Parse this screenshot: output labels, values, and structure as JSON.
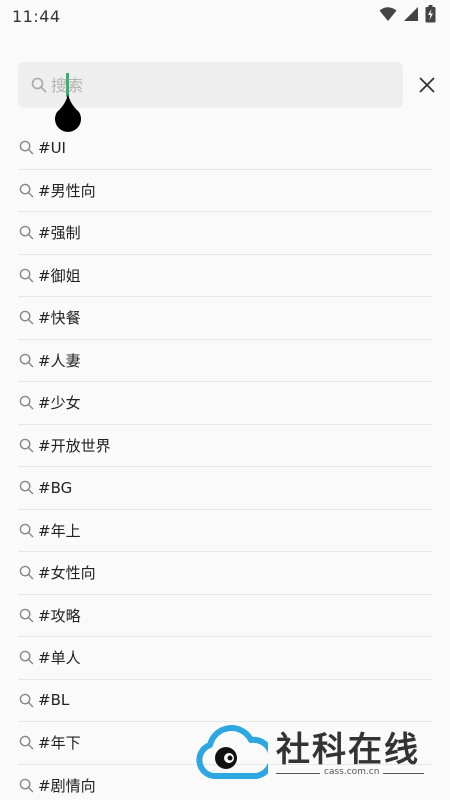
{
  "status_bar": {
    "time": "11:44",
    "icons": [
      "wifi-icon",
      "signal-icon",
      "battery-charging-icon"
    ]
  },
  "search": {
    "placeholder": "搜索",
    "value": "",
    "icon": "search-icon",
    "close_icon": "close-icon"
  },
  "suggestions": [
    {
      "label": "#UI"
    },
    {
      "label": "#男性向"
    },
    {
      "label": "#强制"
    },
    {
      "label": "#御姐"
    },
    {
      "label": "#快餐"
    },
    {
      "label": "#人妻"
    },
    {
      "label": "#少女"
    },
    {
      "label": "#开放世界"
    },
    {
      "label": "#BG"
    },
    {
      "label": "#年上"
    },
    {
      "label": "#女性向"
    },
    {
      "label": "#攻略"
    },
    {
      "label": "#单人"
    },
    {
      "label": "#BL"
    },
    {
      "label": "#年下"
    },
    {
      "label": "#剧情向"
    }
  ],
  "watermark": {
    "title": "社科在线",
    "subtitle": "cass.com.cn"
  },
  "colors": {
    "background": "#fafafa",
    "search_bg": "#eeeeee",
    "cursor": "#35b36b",
    "divider": "#e6e6e6",
    "logo_blue": "#2ea7e0"
  }
}
